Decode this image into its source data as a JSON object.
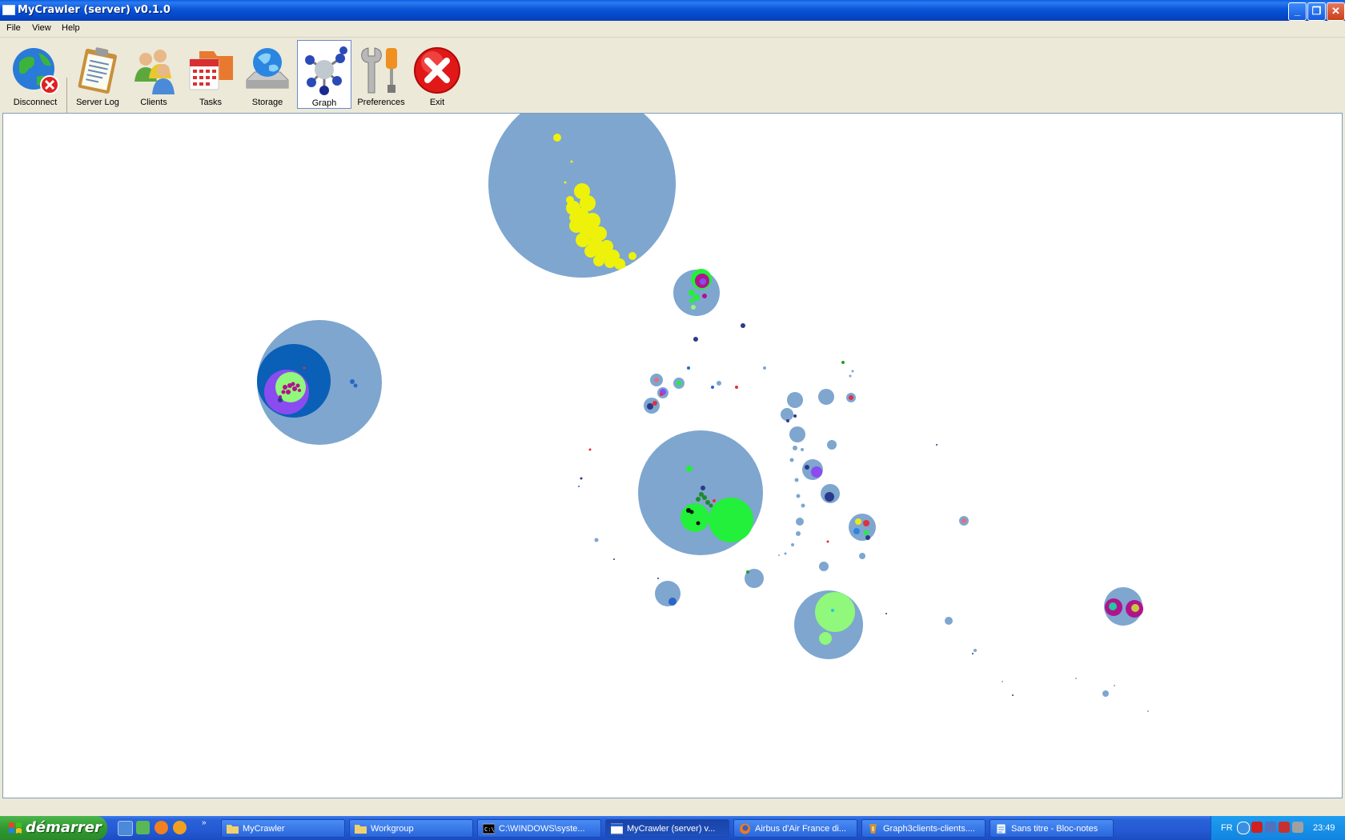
{
  "window": {
    "title": "MyCrawler (server) v0.1.0",
    "minimize": "_",
    "restore": "❐",
    "close": "✕"
  },
  "menu": [
    "File",
    "View",
    "Help"
  ],
  "toolbar": [
    {
      "label": "Disconnect",
      "icon": "globe-disconnect-icon"
    },
    {
      "label": "Server Log",
      "icon": "clipboard-icon"
    },
    {
      "label": "Clients",
      "icon": "users-icon"
    },
    {
      "label": "Tasks",
      "icon": "calendar-folder-icon"
    },
    {
      "label": "Storage",
      "icon": "globe-drive-icon"
    },
    {
      "label": "Graph",
      "icon": "molecule-graph-icon",
      "active": true
    },
    {
      "label": "Preferences",
      "icon": "tools-icon"
    },
    {
      "label": "Exit",
      "icon": "exit-icon"
    }
  ],
  "colors": {
    "cluster": "#7ea6cf",
    "cluster_dark": "#0a5fb6",
    "yellow": "#eef20a",
    "green": "#22f03a",
    "light_green": "#90f87a",
    "purple": "#8a4cf0",
    "magenta": "#b0148c",
    "red": "#e03040",
    "navy": "#2a3a8a"
  },
  "taskbar": {
    "start_label": "démarrer",
    "tasks": [
      {
        "label": "MyCrawler",
        "icon": "folder-icon"
      },
      {
        "label": "Workgroup",
        "icon": "folder-icon"
      },
      {
        "label": "C:\\WINDOWS\\syste...",
        "icon": "console-icon"
      },
      {
        "label": "MyCrawler (server) v...",
        "icon": "window-icon",
        "active": true
      },
      {
        "label": "Airbus d'Air France di...",
        "icon": "firefox-icon"
      },
      {
        "label": "Graph3clients-clients....",
        "icon": "image-icon"
      },
      {
        "label": "Sans titre - Bloc-notes",
        "icon": "notepad-icon"
      }
    ],
    "lang": "FR",
    "clock": "23:49"
  }
}
